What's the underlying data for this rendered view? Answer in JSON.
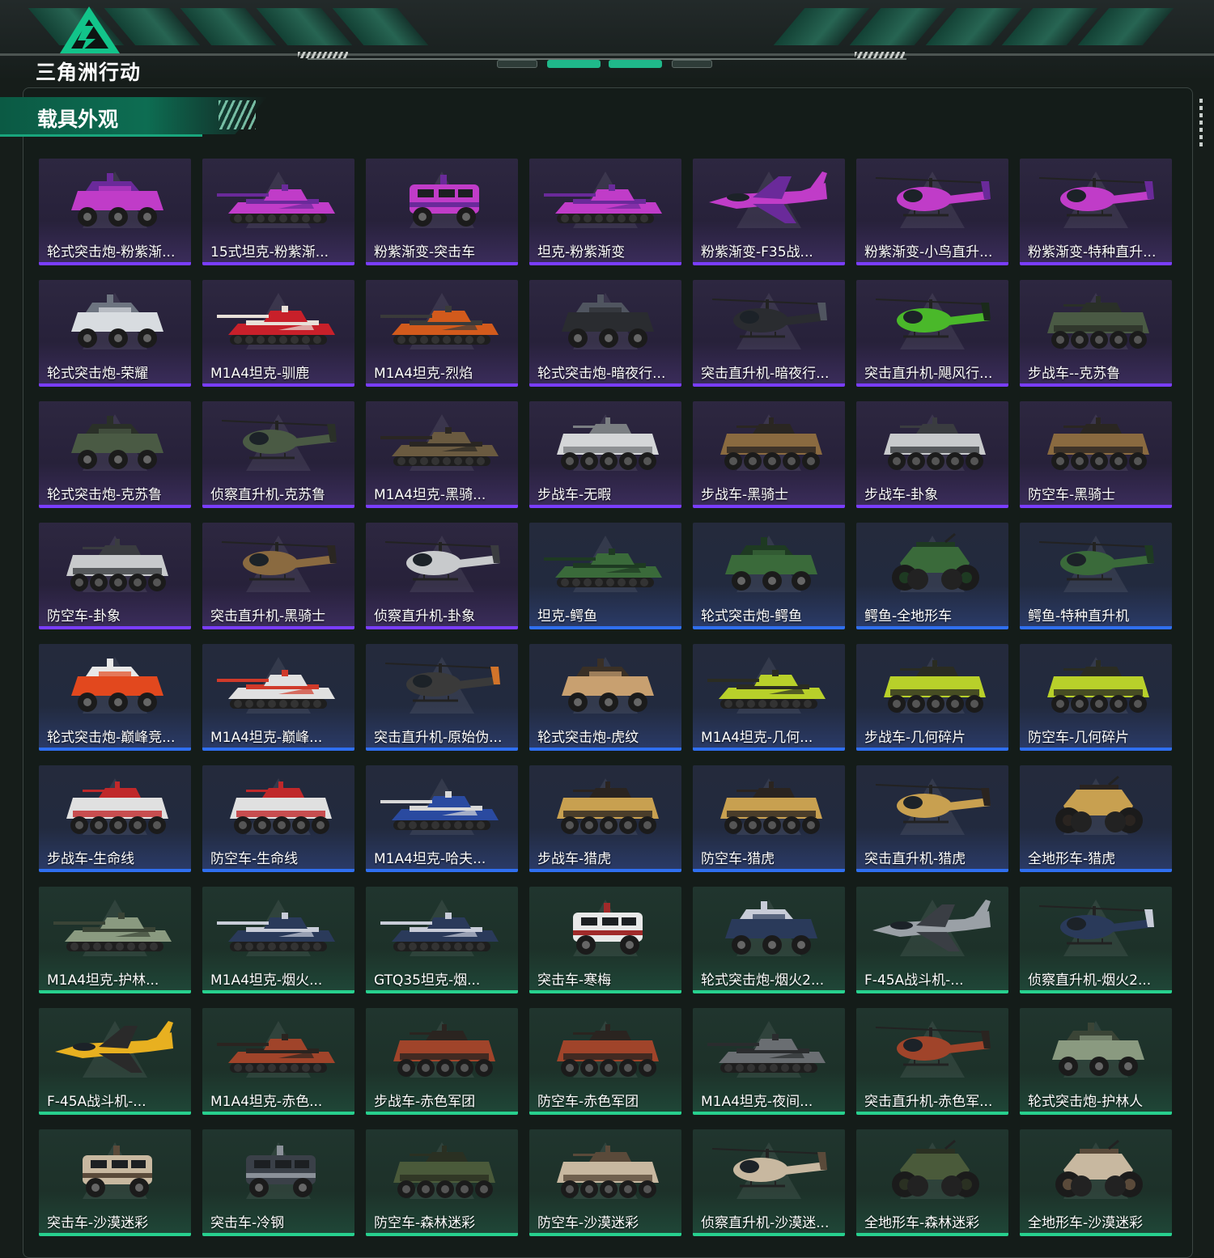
{
  "header": {
    "logo_text": "三角洲行动"
  },
  "section": {
    "title": "载具外观"
  },
  "colors": {
    "accent": "#19a57c",
    "purple_rarity": "#7a3dff",
    "blue_rarity": "#2f6ff0",
    "green_rarity": "#27d08e"
  },
  "items": [
    {
      "label": "轮式突击炮-粉紫渐...",
      "rarity": "purple",
      "type": "apc",
      "c1": "#c03cc8",
      "c2": "#6a2a9a"
    },
    {
      "label": "15式坦克-粉紫渐...",
      "rarity": "purple",
      "type": "tank",
      "c1": "#c03cc8",
      "c2": "#6a2a9a"
    },
    {
      "label": "粉紫渐变-突击车",
      "rarity": "purple",
      "type": "truck",
      "c1": "#c03cc8",
      "c2": "#6a2a9a"
    },
    {
      "label": "坦克-粉紫渐变",
      "rarity": "purple",
      "type": "tank",
      "c1": "#c03cc8",
      "c2": "#6a2a9a"
    },
    {
      "label": "粉紫渐变-F35战...",
      "rarity": "purple",
      "type": "jet",
      "c1": "#c03cc8",
      "c2": "#6a2a9a"
    },
    {
      "label": "粉紫渐变-小鸟直升...",
      "rarity": "purple",
      "type": "heli",
      "c1": "#c03cc8",
      "c2": "#6a2a9a"
    },
    {
      "label": "粉紫渐变-特种直升...",
      "rarity": "purple",
      "type": "heli",
      "c1": "#c03cc8",
      "c2": "#6a2a9a"
    },
    {
      "label": "轮式突击炮-荣耀",
      "rarity": "purple",
      "type": "apc",
      "c1": "#d8dce0",
      "c2": "#6d7480"
    },
    {
      "label": "M1A4坦克-驯鹿",
      "rarity": "purple",
      "type": "tank",
      "c1": "#c8202a",
      "c2": "#e8e0d8"
    },
    {
      "label": "M1A4坦克-烈焰",
      "rarity": "purple",
      "type": "tank",
      "c1": "#d25a1c",
      "c2": "#3a3a3a"
    },
    {
      "label": "轮式突击炮-暗夜行...",
      "rarity": "purple",
      "type": "apc",
      "c1": "#2a2c30",
      "c2": "#505560"
    },
    {
      "label": "突击直升机-暗夜行...",
      "rarity": "purple",
      "type": "heli",
      "c1": "#2a2c30",
      "c2": "#505560"
    },
    {
      "label": "突击直升机-飓风行...",
      "rarity": "purple",
      "type": "heli",
      "c1": "#4ab82a",
      "c2": "#1a2a1a"
    },
    {
      "label": "步战车--克苏鲁",
      "rarity": "purple",
      "type": "ifv",
      "c1": "#4a5a44",
      "c2": "#2a3028"
    },
    {
      "label": "轮式突击炮-克苏鲁",
      "rarity": "purple",
      "type": "apc",
      "c1": "#4a5a44",
      "c2": "#2a3028"
    },
    {
      "label": "侦察直升机-克苏鲁",
      "rarity": "purple",
      "type": "heli",
      "c1": "#4a5a44",
      "c2": "#2a3028"
    },
    {
      "label": "M1A4坦克-黑骑...",
      "rarity": "purple",
      "type": "tank",
      "c1": "#6a5a40",
      "c2": "#2a2622"
    },
    {
      "label": "步战车-无暇",
      "rarity": "purple",
      "type": "ifv",
      "c1": "#d4d6d8",
      "c2": "#7a7e82"
    },
    {
      "label": "步战车-黑骑士",
      "rarity": "purple",
      "type": "ifv",
      "c1": "#8a6a40",
      "c2": "#2a2622"
    },
    {
      "label": "步战车-卦象",
      "rarity": "purple",
      "type": "ifv",
      "c1": "#c8cacc",
      "c2": "#3a3c40"
    },
    {
      "label": "防空车-黑骑士",
      "rarity": "purple",
      "type": "ifv",
      "c1": "#8a6a40",
      "c2": "#2a2622"
    },
    {
      "label": "防空车-卦象",
      "rarity": "purple",
      "type": "ifv",
      "c1": "#c8cacc",
      "c2": "#3a3c40"
    },
    {
      "label": "突击直升机-黑骑士",
      "rarity": "purple",
      "type": "heli",
      "c1": "#8a6a40",
      "c2": "#2a2622"
    },
    {
      "label": "侦察直升机-卦象",
      "rarity": "purple",
      "type": "heli",
      "c1": "#c8cacc",
      "c2": "#3a3c40"
    },
    {
      "label": "坦克-鳄鱼",
      "rarity": "blue",
      "type": "tank",
      "c1": "#3a6a3a",
      "c2": "#1e3a22"
    },
    {
      "label": "轮式突击炮-鳄鱼",
      "rarity": "blue",
      "type": "apc",
      "c1": "#3a6a3a",
      "c2": "#1e3a22"
    },
    {
      "label": "鳄鱼-全地形车",
      "rarity": "blue",
      "type": "atv",
      "c1": "#3a6a3a",
      "c2": "#1e3a22"
    },
    {
      "label": "鳄鱼-特种直升机",
      "rarity": "blue",
      "type": "heli",
      "c1": "#3a6a3a",
      "c2": "#1e3a22"
    },
    {
      "label": "轮式突击炮-巅峰竞...",
      "rarity": "blue",
      "type": "apc",
      "c1": "#e2481e",
      "c2": "#e8e8e8"
    },
    {
      "label": "M1A4坦克-巅峰...",
      "rarity": "blue",
      "type": "tank",
      "c1": "#e0e0e0",
      "c2": "#d03a2a"
    },
    {
      "label": "突击直升机-原始伪...",
      "rarity": "blue",
      "type": "heli",
      "c1": "#3a3a3a",
      "c2": "#d2742a"
    },
    {
      "label": "轮式突击炮-虎纹",
      "rarity": "blue",
      "type": "apc",
      "c1": "#c8a070",
      "c2": "#3a3026"
    },
    {
      "label": "M1A4坦克-几何...",
      "rarity": "blue",
      "type": "tank",
      "c1": "#b8d02a",
      "c2": "#2a2c22"
    },
    {
      "label": "步战车-几何碎片",
      "rarity": "blue",
      "type": "ifv",
      "c1": "#b8d02a",
      "c2": "#2a2c22"
    },
    {
      "label": "防空车-几何碎片",
      "rarity": "blue",
      "type": "ifv",
      "c1": "#b8d02a",
      "c2": "#2a2c22"
    },
    {
      "label": "步战车-生命线",
      "rarity": "blue",
      "type": "ifv",
      "c1": "#e0e0e0",
      "c2": "#c0282a"
    },
    {
      "label": "防空车-生命线",
      "rarity": "blue",
      "type": "ifv",
      "c1": "#e0e0e0",
      "c2": "#c0282a"
    },
    {
      "label": "M1A4坦克-哈夫...",
      "rarity": "blue",
      "type": "tank",
      "c1": "#2a4aa0",
      "c2": "#d8d8d8"
    },
    {
      "label": "步战车-猎虎",
      "rarity": "blue",
      "type": "ifv",
      "c1": "#c8a050",
      "c2": "#2a2420"
    },
    {
      "label": "防空车-猎虎",
      "rarity": "blue",
      "type": "ifv",
      "c1": "#c8a050",
      "c2": "#2a2420"
    },
    {
      "label": "突击直升机-猎虎",
      "rarity": "blue",
      "type": "heli",
      "c1": "#c8a050",
      "c2": "#2a2420"
    },
    {
      "label": "全地形车-猎虎",
      "rarity": "blue",
      "type": "atv",
      "c1": "#c8a050",
      "c2": "#2a2420"
    },
    {
      "label": "M1A4坦克-护林...",
      "rarity": "green",
      "type": "tank",
      "c1": "#8a9a80",
      "c2": "#3a4436"
    },
    {
      "label": "M1A4坦克-烟火...",
      "rarity": "green",
      "type": "tank",
      "c1": "#2a3a5a",
      "c2": "#c8ccd8"
    },
    {
      "label": "GTQ35坦克-烟...",
      "rarity": "green",
      "type": "tank",
      "c1": "#2a3a5a",
      "c2": "#c8ccd8"
    },
    {
      "label": "突击车-寒梅",
      "rarity": "green",
      "type": "truck",
      "c1": "#e8e8e8",
      "c2": "#a02a2a"
    },
    {
      "label": "轮式突击炮-烟火2...",
      "rarity": "green",
      "type": "apc",
      "c1": "#2a3a5a",
      "c2": "#c8ccd8"
    },
    {
      "label": "F-45A战斗机-...",
      "rarity": "green",
      "type": "jet",
      "c1": "#9aa0a6",
      "c2": "#3a3e44"
    },
    {
      "label": "侦察直升机-烟火2...",
      "rarity": "green",
      "type": "heli",
      "c1": "#2a3a5a",
      "c2": "#c8ccd8"
    },
    {
      "label": "F-45A战斗机-...",
      "rarity": "green",
      "type": "jet",
      "c1": "#e8b020",
      "c2": "#2a2a2a"
    },
    {
      "label": "M1A4坦克-赤色...",
      "rarity": "green",
      "type": "tank",
      "c1": "#a0442a",
      "c2": "#2a2420"
    },
    {
      "label": "步战车-赤色军团",
      "rarity": "green",
      "type": "ifv",
      "c1": "#a0442a",
      "c2": "#2a2420"
    },
    {
      "label": "防空车-赤色军团",
      "rarity": "green",
      "type": "ifv",
      "c1": "#a0442a",
      "c2": "#2a2420"
    },
    {
      "label": "M1A4坦克-夜间...",
      "rarity": "green",
      "type": "tank",
      "c1": "#6a6e72",
      "c2": "#2a2c2e"
    },
    {
      "label": "突击直升机-赤色军...",
      "rarity": "green",
      "type": "heli",
      "c1": "#a0442a",
      "c2": "#2a2420"
    },
    {
      "label": "轮式突击炮-护林人",
      "rarity": "green",
      "type": "apc",
      "c1": "#8a9a80",
      "c2": "#3a4436"
    },
    {
      "label": "突击车-沙漠迷彩",
      "rarity": "green",
      "type": "truck",
      "c1": "#c8b8a0",
      "c2": "#5a4a3a"
    },
    {
      "label": "突击车-冷钢",
      "rarity": "green",
      "type": "truck",
      "c1": "#3a4048",
      "c2": "#8a9098"
    },
    {
      "label": "防空车-森林迷彩",
      "rarity": "green",
      "type": "ifv",
      "c1": "#4a5a3a",
      "c2": "#2a3022"
    },
    {
      "label": "防空车-沙漠迷彩",
      "rarity": "green",
      "type": "ifv",
      "c1": "#c8b8a0",
      "c2": "#5a4a3a"
    },
    {
      "label": "侦察直升机-沙漠迷...",
      "rarity": "green",
      "type": "heli",
      "c1": "#c8b8a0",
      "c2": "#5a4a3a"
    },
    {
      "label": "全地形车-森林迷彩",
      "rarity": "green",
      "type": "atv",
      "c1": "#4a5a3a",
      "c2": "#2a3022"
    },
    {
      "label": "全地形车-沙漠迷彩",
      "rarity": "green",
      "type": "atv",
      "c1": "#c8b8a0",
      "c2": "#5a4a3a"
    }
  ]
}
